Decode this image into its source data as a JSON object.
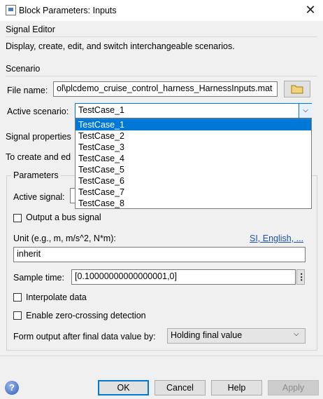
{
  "window": {
    "title": "Block Parameters: Inputs"
  },
  "signal_editor": {
    "heading": "Signal Editor",
    "description": "Display, create, edit, and switch interchangeable scenarios."
  },
  "scenario": {
    "heading": "Scenario",
    "file_name_label": "File name:",
    "file_name_value": "ol\\plcdemo_cruise_control_harness_HarnessInputs.mat",
    "active_scenario_label": "Active scenario:",
    "active_scenario_value": "TestCase_1",
    "options": [
      "TestCase_1",
      "TestCase_2",
      "TestCase_3",
      "TestCase_4",
      "TestCase_5",
      "TestCase_6",
      "TestCase_7",
      "TestCase_8"
    ]
  },
  "signal_properties": {
    "heading": "Signal properties",
    "text": "To create and ed"
  },
  "parameters": {
    "heading": "Parameters",
    "active_signal_label": "Active signal:",
    "output_bus_label": "Output a bus signal",
    "unit_label": "Unit (e.g., m, m/s^2, N*m):",
    "unit_link": "SI, English, ...",
    "unit_value": "inherit",
    "sample_time_label": "Sample time:",
    "sample_time_value": "[0.10000000000000001,0]",
    "interpolate_label": "Interpolate data",
    "zero_crossing_label": "Enable zero-crossing detection",
    "form_output_label": "Form output after final data value by:",
    "form_output_value": "Holding final value"
  },
  "buttons": {
    "ok": "OK",
    "cancel": "Cancel",
    "help": "Help",
    "apply": "Apply"
  },
  "colors": {
    "selection": "#0078d7",
    "link": "#1b4fb0",
    "apply_disabled_text": "#8a8a8a"
  }
}
